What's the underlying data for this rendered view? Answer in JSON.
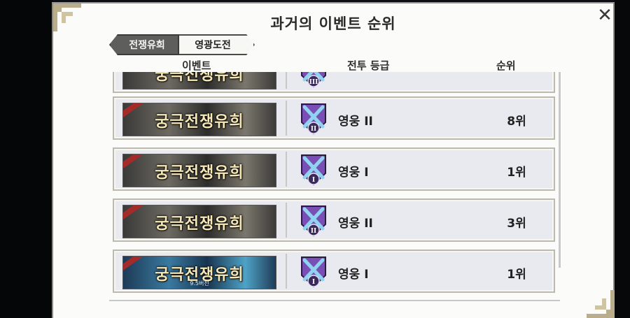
{
  "modal": {
    "title": "과거의 이벤트 순위",
    "close_label": "✕"
  },
  "tabs": [
    {
      "label": "전쟁유희",
      "active": true
    },
    {
      "label": "영광도전",
      "active": false
    }
  ],
  "columns": {
    "event": "이벤트",
    "grade": "전투 등급",
    "rank": "순위"
  },
  "rows": [
    {
      "banner_text": "궁극전쟁유희",
      "banner_sub": "",
      "emblem_roman": "III",
      "grade": "",
      "rank": ""
    },
    {
      "banner_text": "궁극전쟁유희",
      "banner_sub": "",
      "emblem_roman": "II",
      "grade": "영웅 II",
      "rank": "8위"
    },
    {
      "banner_text": "궁극전쟁유희",
      "banner_sub": "",
      "emblem_roman": "I",
      "grade": "영웅 I",
      "rank": "1위"
    },
    {
      "banner_text": "궁극전쟁유희",
      "banner_sub": "",
      "emblem_roman": "II",
      "grade": "영웅 II",
      "rank": "3위"
    },
    {
      "banner_text": "궁극전쟁유희",
      "banner_sub": "9.5버전",
      "emblem_roman": "I",
      "grade": "영웅 I",
      "rank": "1위"
    }
  ],
  "colors": {
    "accent_active_tab": "#5e5e5c",
    "emblem_purple": "#7a4fb5",
    "emblem_blue": "#8fd3f0"
  }
}
